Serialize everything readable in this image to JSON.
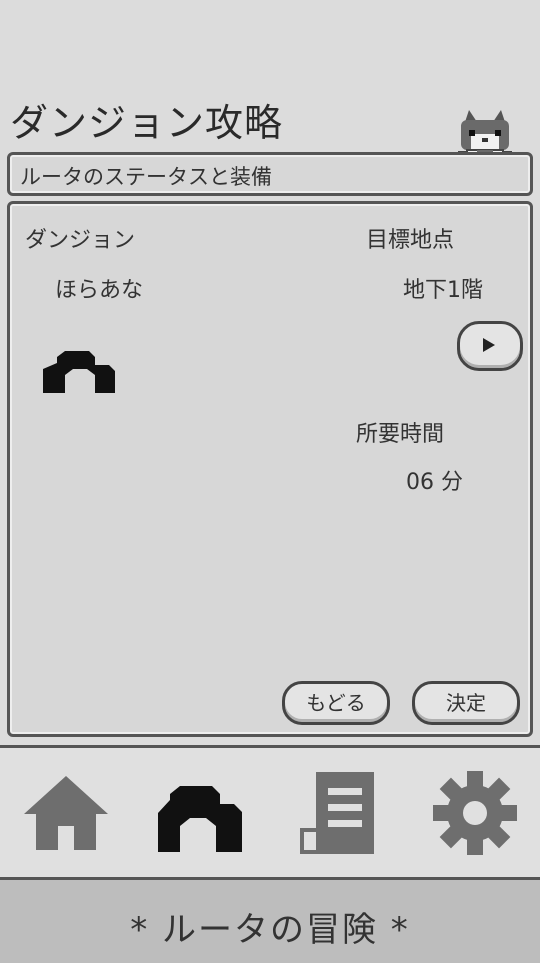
{
  "header": {
    "title": "ダンジョン攻略",
    "subtitle": "ルータのステータスと装備"
  },
  "panel": {
    "dungeon_label": "ダンジョン",
    "dungeon_name": "ほらあな",
    "target_label": "目標地点",
    "target_value": "地下1階",
    "duration_label": "所要時間",
    "duration_value": "06 分",
    "back_button": "もどる",
    "confirm_button": "決定",
    "next_icon": "play-triangle-icon",
    "dungeon_icon": "cave-icon"
  },
  "nav": {
    "items": [
      {
        "icon": "home-icon",
        "active": false
      },
      {
        "icon": "cave-icon",
        "active": true
      },
      {
        "icon": "scroll-icon",
        "active": false
      },
      {
        "icon": "gear-icon",
        "active": false
      }
    ]
  },
  "footer": {
    "title": "* ルータの冒険 *"
  },
  "colors": {
    "background": "#dcdcdc",
    "border": "#555555",
    "active_icon": "#111111",
    "inactive_icon": "#6e6e6e"
  }
}
